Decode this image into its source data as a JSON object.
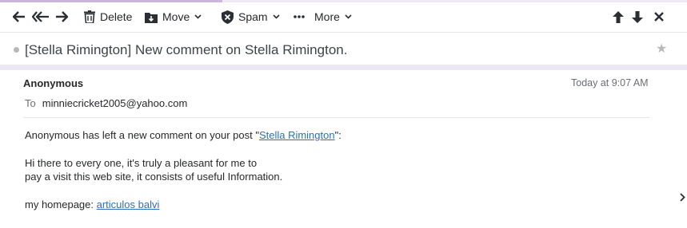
{
  "toolbar": {
    "back_icon": "reply-arrow-icon",
    "reply_all_icon": "reply-all-icon",
    "forward_icon": "forward-icon",
    "delete_label": "Delete",
    "move_label": "Move",
    "spam_label": "Spam",
    "more_label": "More",
    "close_icon": "close-icon"
  },
  "message": {
    "subject": "[Stella Rimington] New comment on Stella Rimington.",
    "sender": "Anonymous",
    "date": "Today at 9:07 AM",
    "to_label": "To",
    "to_address": "minniecricket2005@yahoo.com",
    "intro_prefix": "Anonymous has left a new comment on your post \"",
    "post_link": "Stella Rimington",
    "intro_suffix": "\":",
    "line1": "Hi there to every one, it's truly a pleasant for me to",
    "line2": "pay a visit this web site, it consists of useful Information.",
    "homepage_prefix": "my homepage: ",
    "homepage_link": "articulos balvi"
  },
  "colors": {
    "accent": "#c9b8dc",
    "link": "#2f6fb6",
    "text": "#26282a"
  }
}
